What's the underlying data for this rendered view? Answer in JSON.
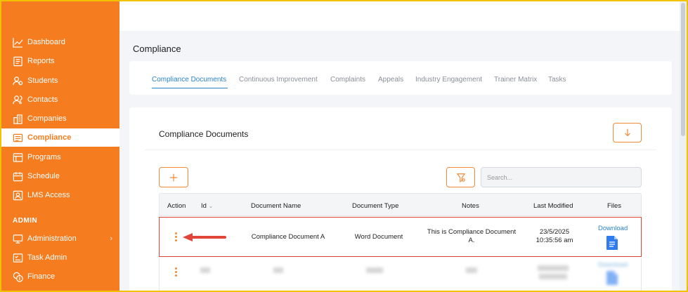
{
  "sidebar": {
    "items": [
      {
        "label": "Dashboard",
        "icon": "chart-line-icon"
      },
      {
        "label": "Reports",
        "icon": "report-icon"
      },
      {
        "label": "Students",
        "icon": "students-icon"
      },
      {
        "label": "Contacts",
        "icon": "contacts-icon"
      },
      {
        "label": "Companies",
        "icon": "buildings-icon"
      },
      {
        "label": "Compliance",
        "icon": "compliance-icon",
        "active": true
      },
      {
        "label": "Programs",
        "icon": "programs-icon"
      },
      {
        "label": "Schedule",
        "icon": "calendar-icon"
      },
      {
        "label": "LMS Access",
        "icon": "lms-icon"
      }
    ],
    "admin_title": "ADMIN",
    "admin_items": [
      {
        "label": "Administration",
        "icon": "monitor-icon",
        "has_submenu": true
      },
      {
        "label": "Task Admin",
        "icon": "task-icon"
      },
      {
        "label": "Finance",
        "icon": "coins-icon"
      }
    ],
    "bg_color": "#f57c1f"
  },
  "page": {
    "title": "Compliance"
  },
  "tabs": [
    {
      "label": "Compliance Documents",
      "active": true
    },
    {
      "label": "Continuous Improvement"
    },
    {
      "label": "Complaints"
    },
    {
      "label": "Appeals"
    },
    {
      "label": "Industry Engagement"
    },
    {
      "label": "Trainer Matrix"
    },
    {
      "label": "Tasks"
    }
  ],
  "card": {
    "title": "Compliance Documents",
    "search_placeholder": "Search..."
  },
  "table": {
    "columns": [
      "Action",
      "Id",
      "Document Name",
      "Document Type",
      "Notes",
      "Last Modified",
      "Files"
    ],
    "rows": [
      {
        "id": "",
        "document_name": "Compliance Document A",
        "document_type": "Word Document",
        "notes_line1": "This is Compliance Document",
        "notes_line2": "A.",
        "modified_date": "23/5/2025",
        "modified_time": "10:35:56 am",
        "files_link": "Download",
        "highlighted": true
      },
      {
        "id": "",
        "document_name": "",
        "document_type": "",
        "notes_line1": "",
        "notes_line2": "",
        "modified_date": "",
        "modified_time": "",
        "files_link": "Download",
        "blurred": true
      }
    ]
  },
  "colors": {
    "accent": "#f57c1f",
    "link": "#2a84c8",
    "highlight_border": "#e0453a"
  }
}
